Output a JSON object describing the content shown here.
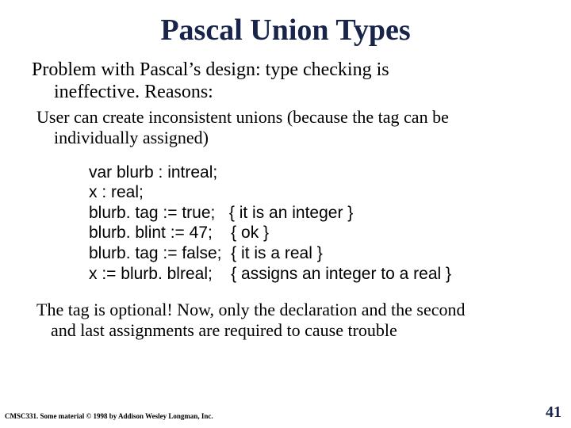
{
  "title": "Pascal Union Types",
  "problem_l1": "Problem with Pascal’s design: type checking is",
  "problem_l2": "ineffective.  Reasons:",
  "reason_l1": "User can create inconsistent unions (because  the tag can be",
  "reason_l2": "individually assigned)",
  "code": "var blurb : intreal;\nx : real;\nblurb. tag := true;   { it is an integer }\nblurb. blint := 47;    { ok }\nblurb. tag := false;  { it is a real }\nx := blurb. blreal;    { assigns an integer to a real }",
  "closing_l1": "The tag is optional! Now, only the declaration and the second",
  "closing_l2": "and last assignments are required to cause trouble",
  "footer_left": "CMSC331.  Some material © 1998 by Addison Wesley Longman, Inc.",
  "slide_number": "41"
}
